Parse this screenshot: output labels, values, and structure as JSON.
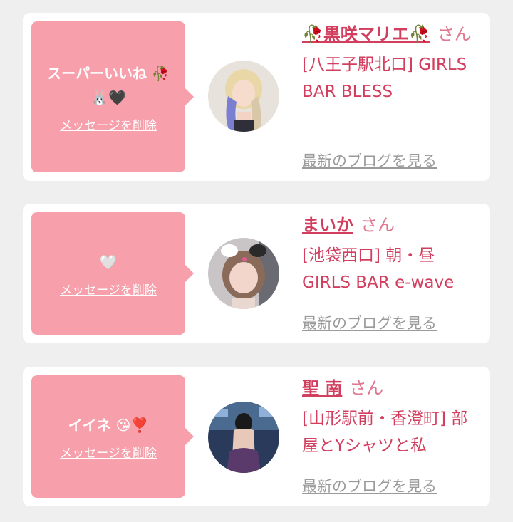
{
  "likes": [
    {
      "message": "スーパーいいね 🥀🐰🖤",
      "delete_label": "メッセージを削除",
      "avatar_icon": "avatar-woman-blonde",
      "name": "🥀黒咲マリエ🥀",
      "honorific": "さん",
      "shop": "[八王子駅北口] GIRLS BAR BLESS",
      "blog_label": "最新のブログを見る"
    },
    {
      "message": "🤍",
      "delete_label": "メッセージを削除",
      "avatar_icon": "avatar-woman-bunny-ears",
      "name": "まいか",
      "honorific": "さん",
      "shop": "[池袋西口] 朝・昼 GIRLS BAR e-wave",
      "blog_label": "最新のブログを見る"
    },
    {
      "message": "イイネ 😘❣️",
      "delete_label": "メッセージを削除",
      "avatar_icon": "avatar-woman-back",
      "name": "聖 南",
      "honorific": "さん",
      "shop": "[山形駅前・香澄町] 部屋とYシャツと私",
      "blog_label": "最新のブログを見る"
    }
  ],
  "colors": {
    "bubble": "#f7a0ab",
    "accent": "#d23e5e",
    "muted": "#9a9a9a",
    "background": "#efefef"
  }
}
